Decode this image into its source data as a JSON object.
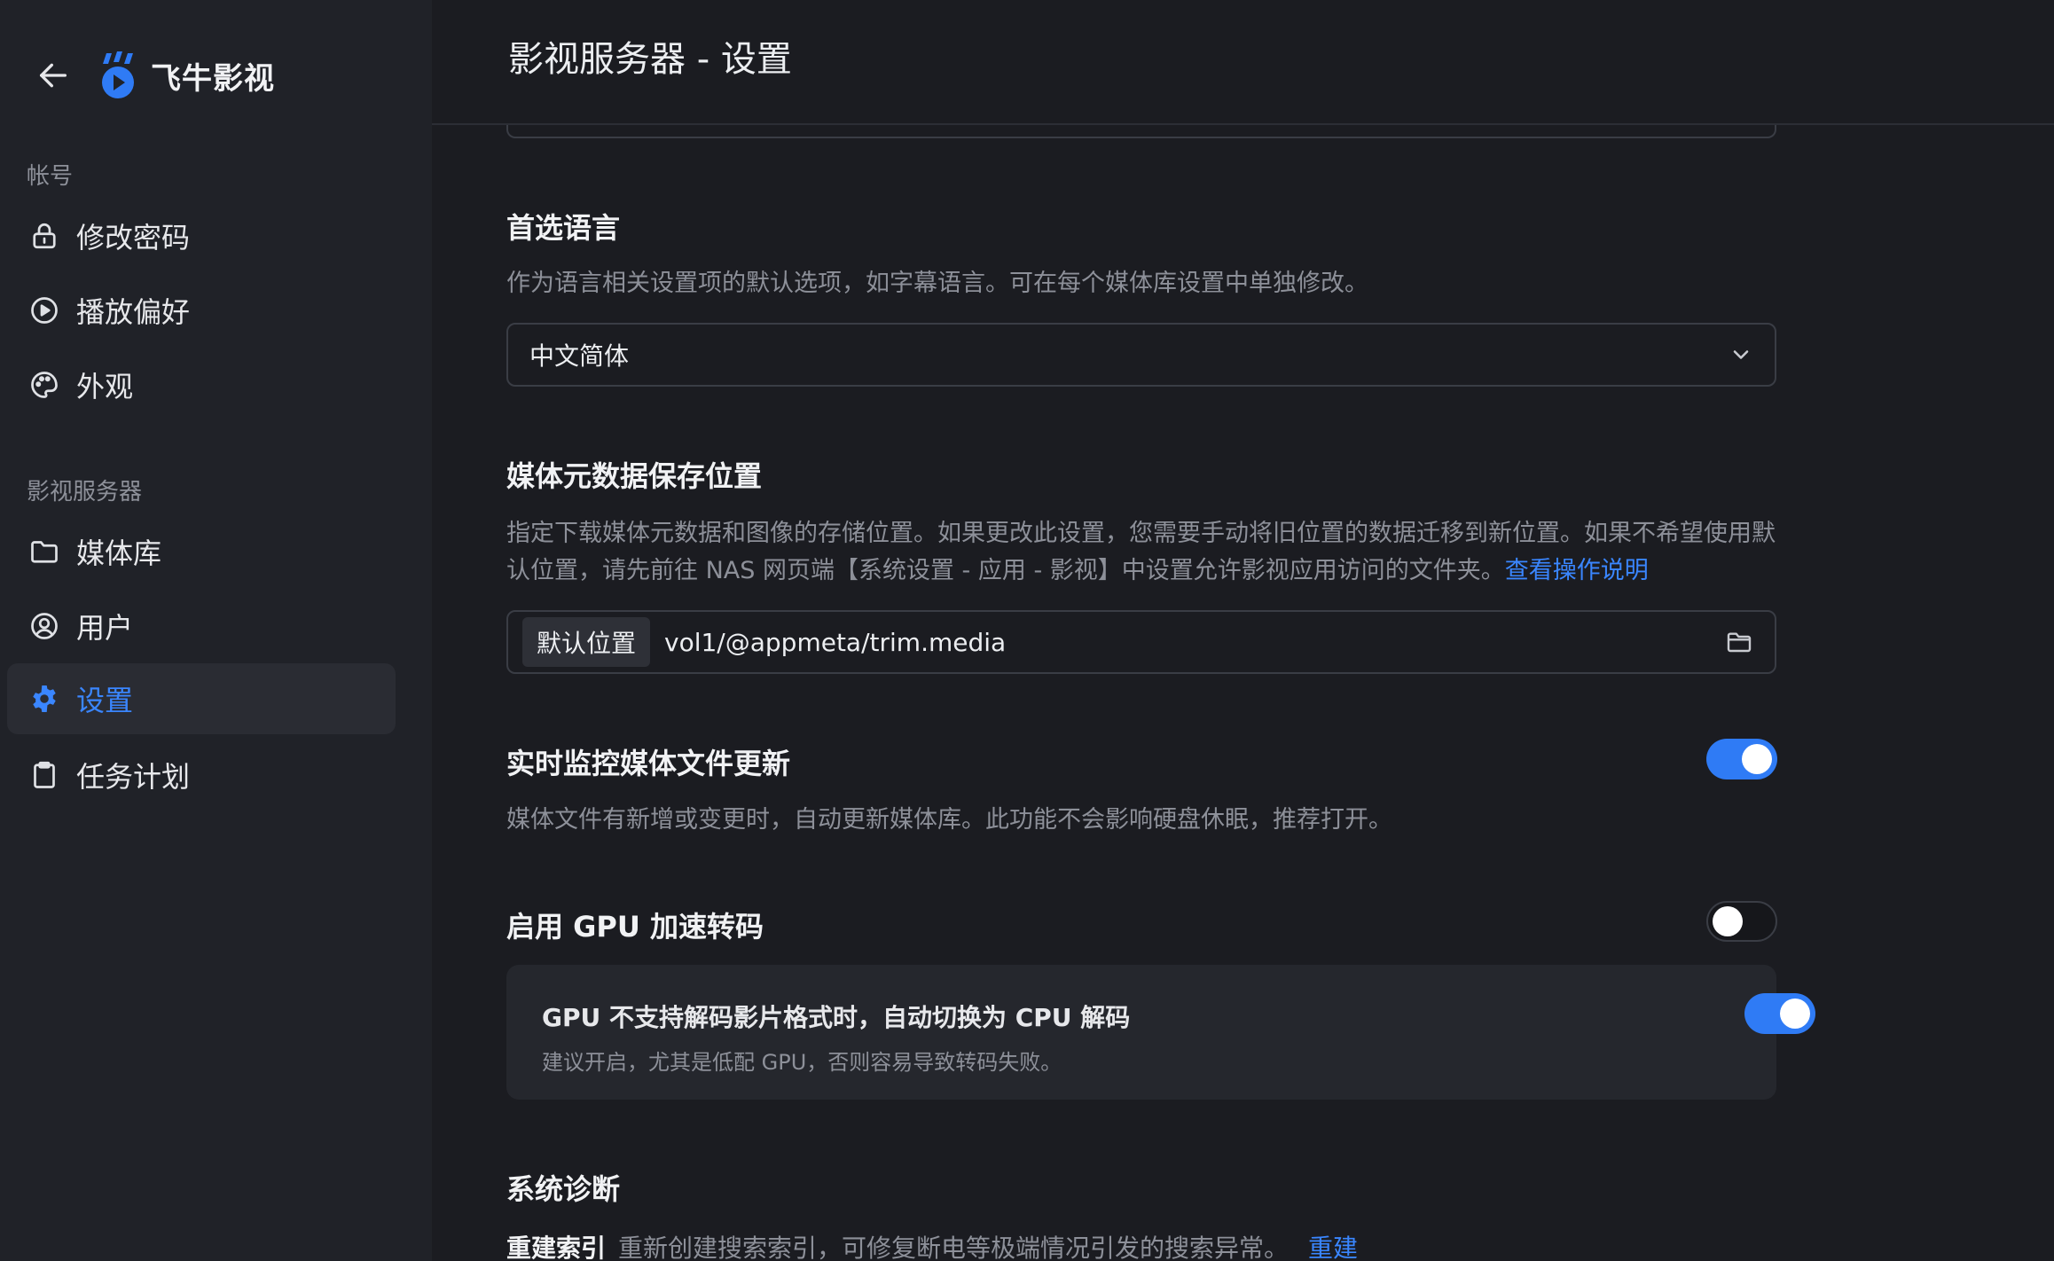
{
  "app": {
    "name": "飞牛影视",
    "accent_color": "#3a86ff"
  },
  "sidebar": {
    "back_icon": "arrow-left-icon",
    "sections": [
      {
        "label": "帐号",
        "items": [
          {
            "label": "修改密码",
            "icon": "lock-icon"
          },
          {
            "label": "播放偏好",
            "icon": "play-circle-icon"
          },
          {
            "label": "外观",
            "icon": "palette-icon"
          }
        ]
      },
      {
        "label": "影视服务器",
        "items": [
          {
            "label": "媒体库",
            "icon": "folder-icon"
          },
          {
            "label": "用户",
            "icon": "user-circle-icon"
          },
          {
            "label": "设置",
            "icon": "gear-icon",
            "active": true
          },
          {
            "label": "任务计划",
            "icon": "clipboard-icon"
          }
        ]
      }
    ]
  },
  "main": {
    "title": "影视服务器 - 设置",
    "language": {
      "title": "首选语言",
      "description": "作为语言相关设置项的默认选项，如字幕语言。可在每个媒体库设置中单独修改。",
      "selected": "中文简体"
    },
    "metadata": {
      "title": "媒体元数据保存位置",
      "description": "指定下载媒体元数据和图像的存储位置。如果更改此设置，您需要手动将旧位置的数据迁移到新位置。如果不希望使用默认位置，请先前往 NAS 网页端【系统设置 - 应用 - 影视】中设置允许影视应用访问的文件夹。",
      "link": "查看操作说明",
      "path_tag": "默认位置",
      "path": "vol1/@appmeta/trim.media"
    },
    "monitor": {
      "title": "实时监控媒体文件更新",
      "description": "媒体文件有新增或变更时，自动更新媒体库。此功能不会影响硬盘休眠，推荐打开。",
      "enabled": true
    },
    "gpu": {
      "title": "启用 GPU 加速转码",
      "enabled": false,
      "fallback": {
        "title": "GPU 不支持解码影片格式时，自动切换为 CPU 解码",
        "description": "建议开启，尤其是低配 GPU，否则容易导致转码失败。",
        "enabled": true
      }
    },
    "diagnostics": {
      "title": "系统诊断",
      "rebuild_label": "重建索引",
      "rebuild_description": "重新创建搜索索引，可修复断电等极端情况引发的搜索异常。",
      "rebuild_action": "重建"
    }
  }
}
